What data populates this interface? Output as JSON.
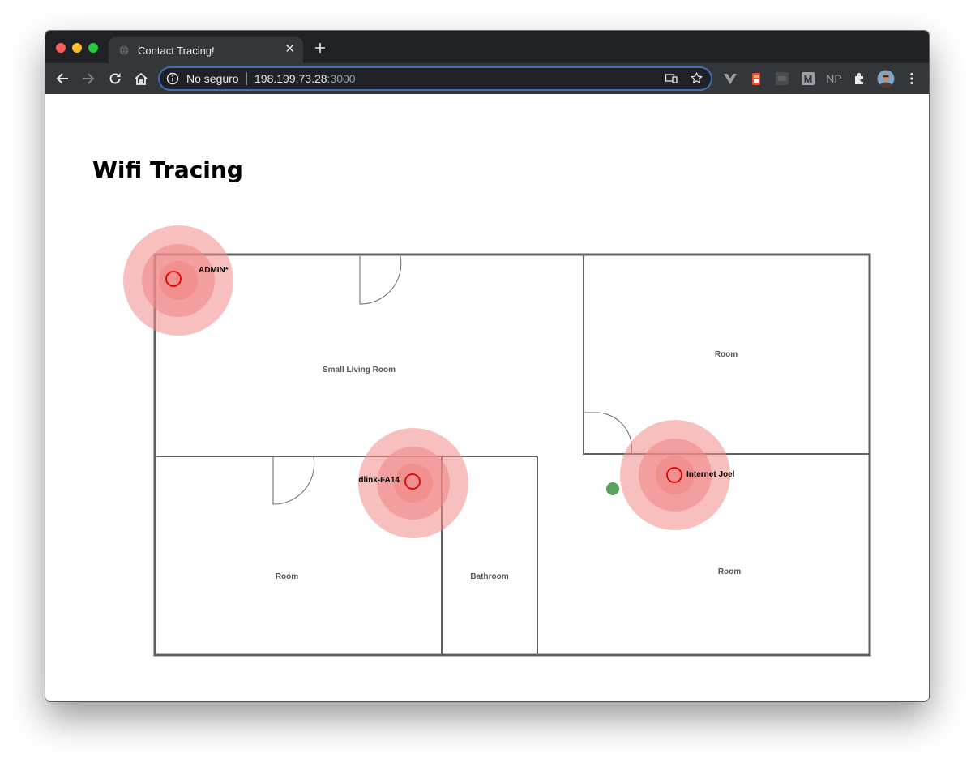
{
  "browser": {
    "tab": {
      "title": "Contact Tracing!",
      "close_glyph": "✕",
      "favicon": "globe-icon"
    },
    "new_tab_glyph": "+",
    "address": {
      "security_label": "No seguro",
      "host": "198.199.73.28",
      "port": ":3000"
    },
    "extensions": [
      "vue-devtools-icon",
      "ext-red-icon",
      "ext-dark-icon",
      "M",
      "NP",
      "puzzle-icon",
      "profile-avatar"
    ]
  },
  "page": {
    "title": "Wifi Tracing",
    "rooms": [
      "Small Living Room",
      "Room",
      "Room",
      "Bathroom",
      "Room"
    ],
    "networks": [
      "ADMIN*",
      "dlink-FA14",
      "Internet Joel"
    ],
    "colors": {
      "signal": "#f28b8b",
      "signal_core_stroke": "#e00000",
      "device": "#5aa25e",
      "wall": "#606060"
    }
  }
}
